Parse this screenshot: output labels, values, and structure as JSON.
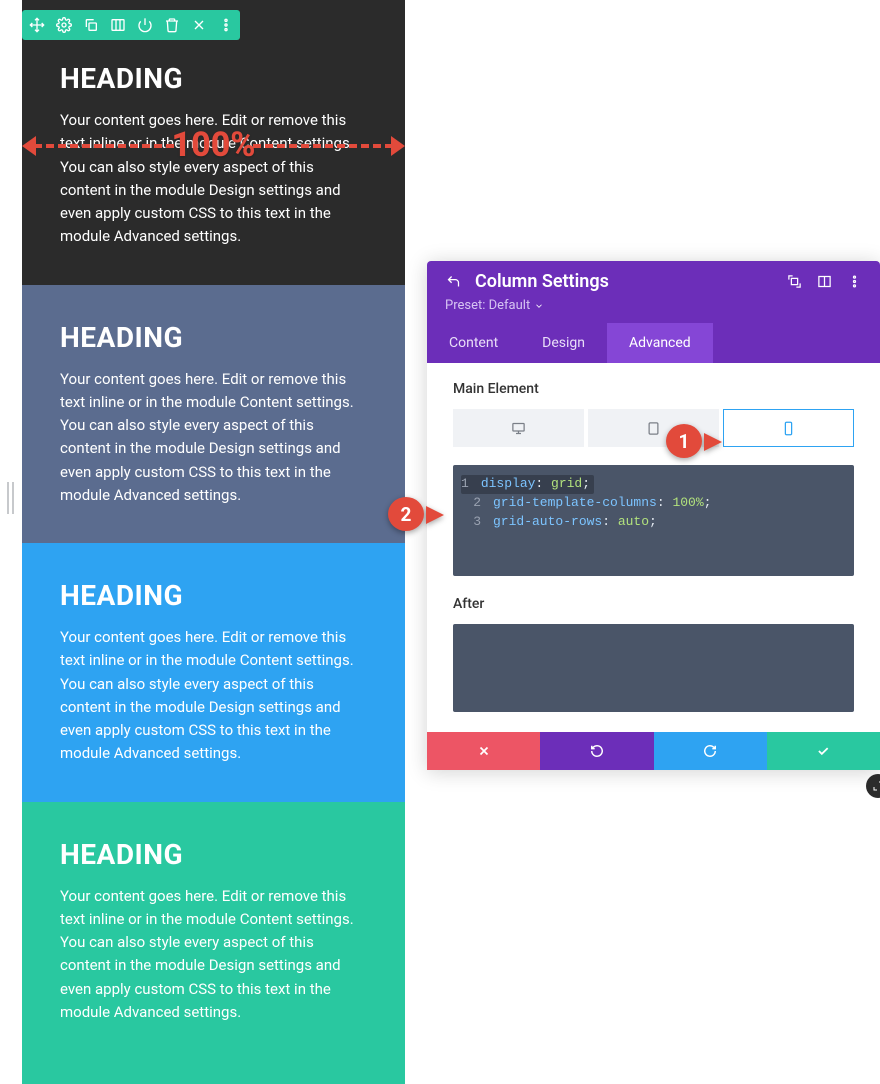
{
  "width_annotation": "100%",
  "blocks": [
    {
      "heading": "HEADING",
      "body": "Your content goes here. Edit or remove this text inline or in the module Content settings. You can also style every aspect of this content in the module Design settings and even apply custom CSS to this text in the module Advanced settings."
    },
    {
      "heading": "HEADING",
      "body": "Your content goes here. Edit or remove this text inline or in the module Content settings. You can also style every aspect of this content in the module Design settings and even apply custom CSS to this text in the module Advanced settings."
    },
    {
      "heading": "HEADING",
      "body": "Your content goes here. Edit or remove this text inline or in the module Content settings. You can also style every aspect of this content in the module Design settings and even apply custom CSS to this text in the module Advanced settings."
    },
    {
      "heading": "HEADING",
      "body": "Your content goes here. Edit or remove this text inline or in the module Content settings. You can also style every aspect of this content in the module Design settings and even apply custom CSS to this text in the module Advanced settings."
    }
  ],
  "panel": {
    "title": "Column Settings",
    "preset_label": "Preset: Default",
    "tabs": {
      "content": "Content",
      "design": "Design",
      "advanced": "Advanced"
    },
    "main_element_label": "Main Element",
    "after_label": "After",
    "code": {
      "l1_prop": "display",
      "l1_val": "grid",
      "l2_prop": "grid-template-columns",
      "l2_val": "100%",
      "l3_prop": "grid-auto-rows",
      "l3_val": "auto"
    }
  },
  "callouts": {
    "one": "1",
    "two": "2"
  }
}
